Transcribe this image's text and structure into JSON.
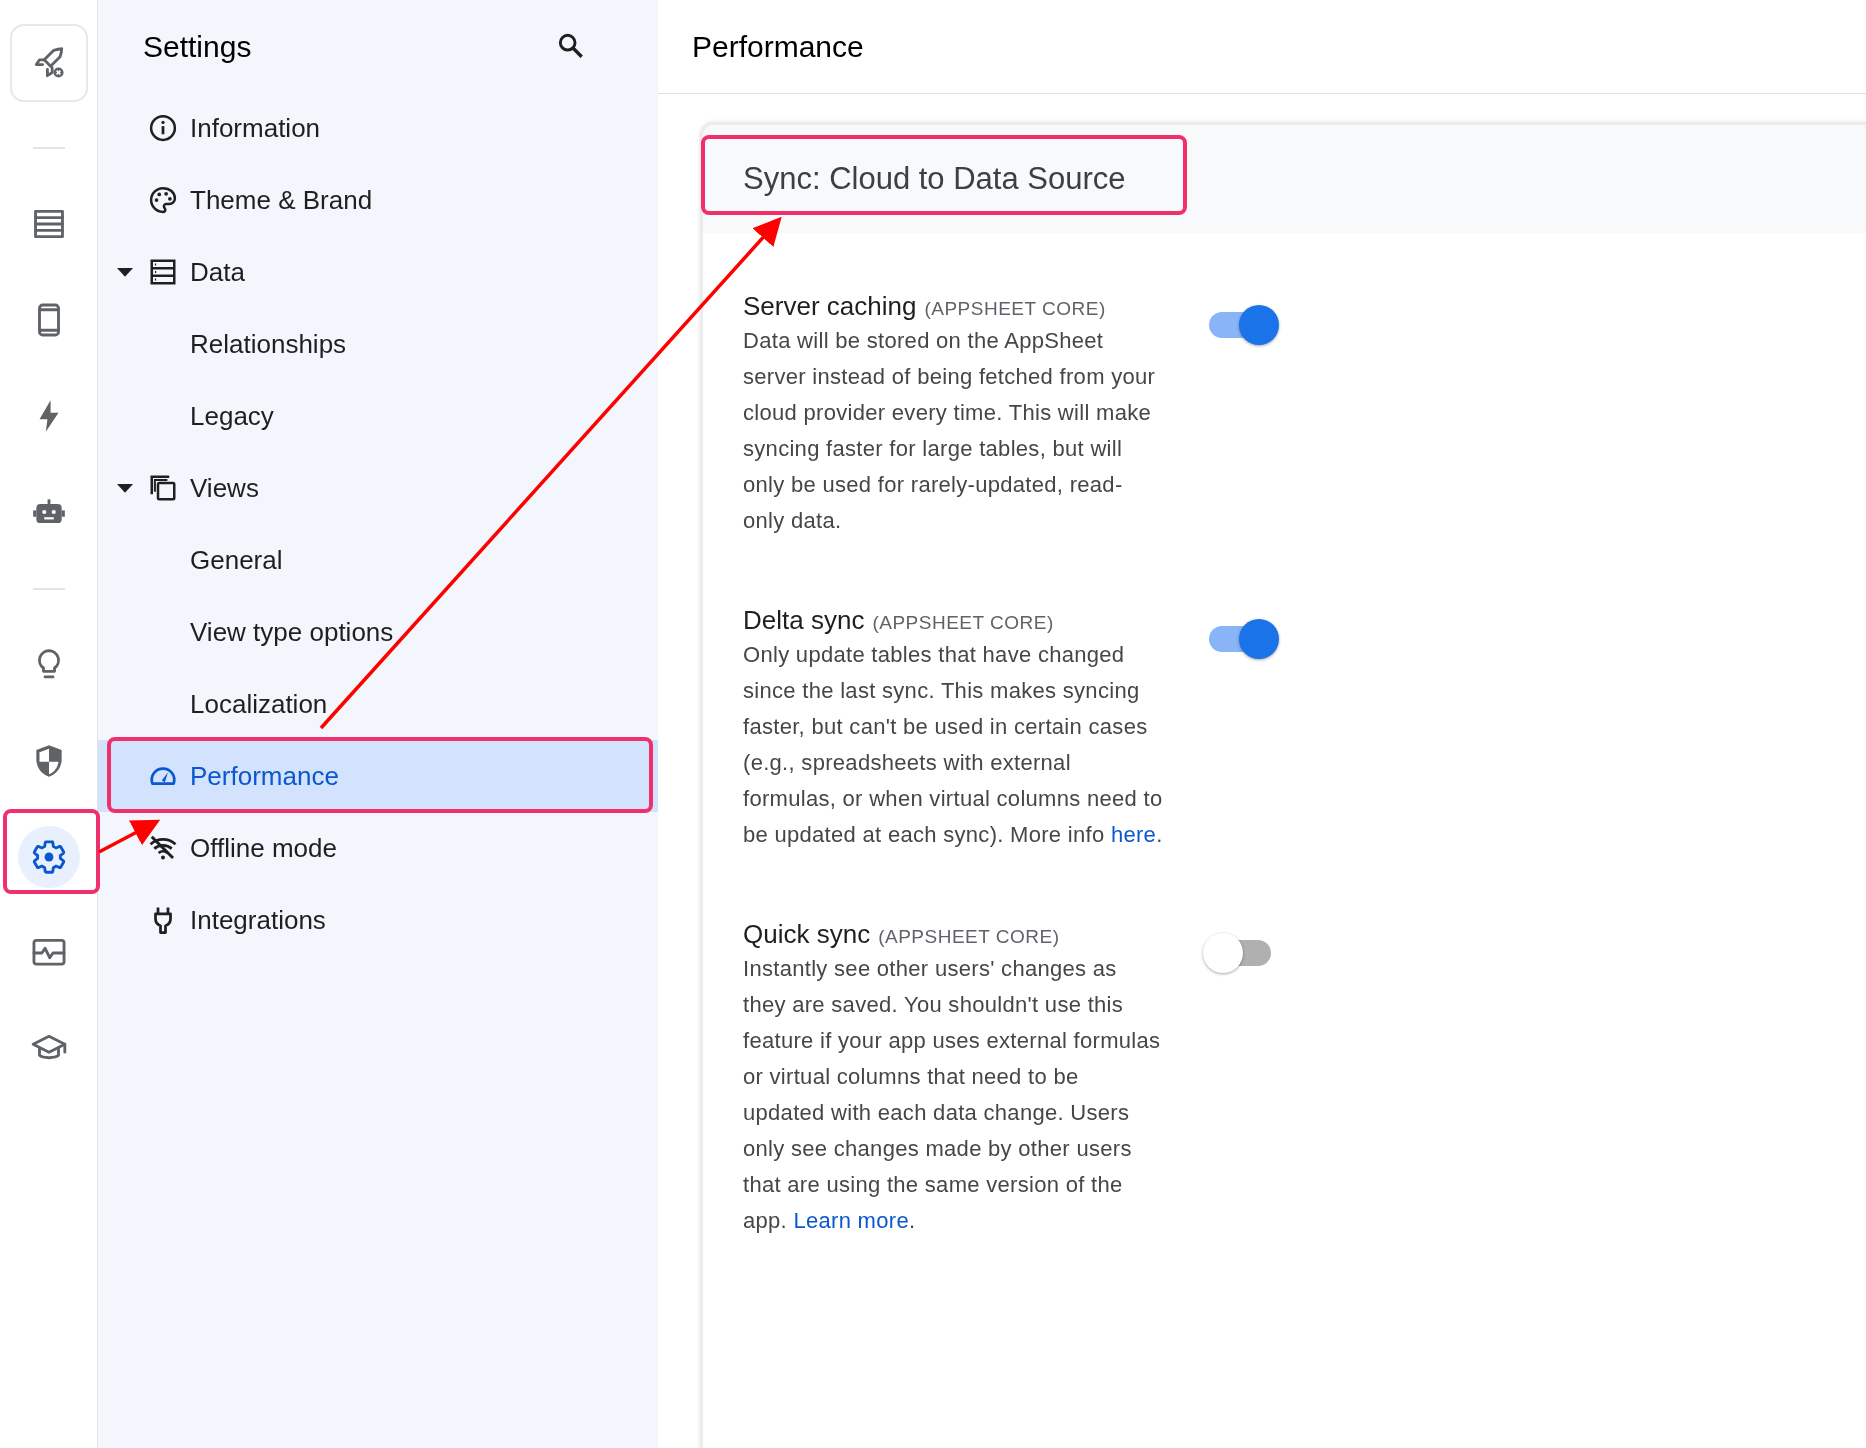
{
  "rail": [
    {
      "kind": "button",
      "selected": false
    },
    {
      "kind": "divider"
    },
    {
      "kind": "button",
      "selected": false
    },
    {
      "kind": "button",
      "selected": false
    },
    {
      "kind": "button",
      "selected": false
    },
    {
      "kind": "button",
      "selected": false
    },
    {
      "kind": "divider"
    },
    {
      "kind": "button",
      "selected": false
    },
    {
      "kind": "button",
      "selected": false
    },
    {
      "kind": "button",
      "selected": true
    },
    {
      "kind": "button",
      "selected": false
    },
    {
      "kind": "button",
      "selected": false
    }
  ],
  "sidebar": {
    "title": "Settings",
    "items": [
      {
        "label": "Information",
        "selected": false
      },
      {
        "label": "Theme & Brand",
        "selected": false
      },
      {
        "label": "Data",
        "selected": false,
        "expanded": true,
        "children": [
          {
            "label": "Relationships",
            "selected": false
          },
          {
            "label": "Legacy",
            "selected": false
          }
        ]
      },
      {
        "label": "Views",
        "selected": false,
        "expanded": true,
        "children": [
          {
            "label": "General",
            "selected": false
          },
          {
            "label": "View type options",
            "selected": false
          },
          {
            "label": "Localization",
            "selected": false
          }
        ]
      },
      {
        "label": "Performance",
        "selected": true
      },
      {
        "label": "Offline mode",
        "selected": false
      },
      {
        "label": "Integrations",
        "selected": false
      }
    ]
  },
  "main": {
    "title": "Performance",
    "section": {
      "title": "Sync: Cloud to Data Source",
      "settings": [
        {
          "title": "Server caching",
          "tag": "(APPSHEET CORE)",
          "description": "Data will be stored on the AppSheet server instead of being fetched from your cloud provider every time. This will make syncing faster for large tables, but will only be used for rarely-updated, read-only data.",
          "on": true
        },
        {
          "title": "Delta sync",
          "tag": "(APPSHEET CORE)",
          "description": "Only update tables that have changed since the last sync. This makes syncing faster, but can't be used in certain cases (e.g., spreadsheets with external formulas, or when virtual columns need to be updated at each sync). More info ",
          "link": "here",
          "after": ".",
          "on": true
        },
        {
          "title": "Quick sync",
          "tag": "(APPSHEET CORE)",
          "description": "Instantly see other users' changes as they are saved. You shouldn't use this feature if your app uses external formulas or virtual columns that need to be updated with each data change. Users only see changes made by other users that are using the same version of the app. ",
          "link": "Learn more",
          "after": ".",
          "on": false
        }
      ]
    }
  }
}
